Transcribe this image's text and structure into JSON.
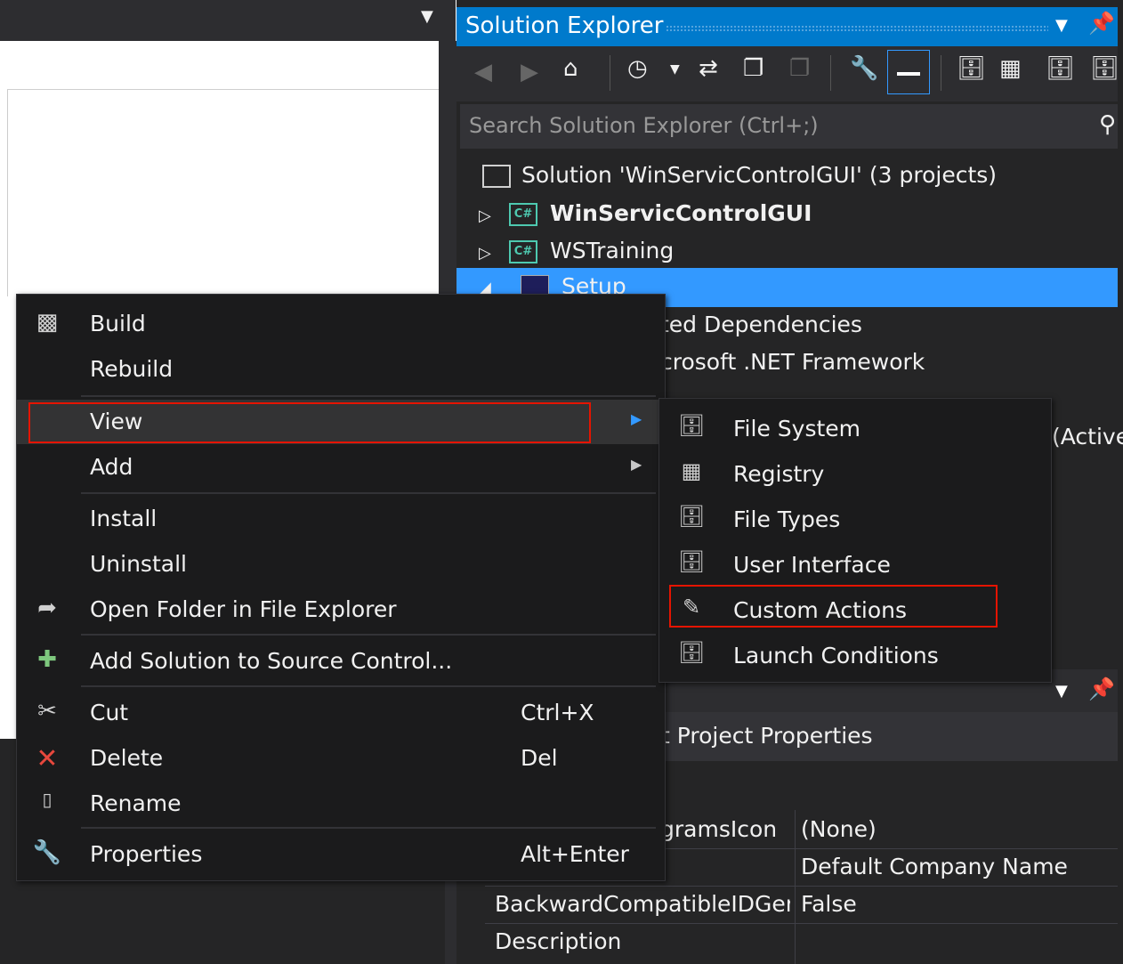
{
  "solution_explorer": {
    "title": "Solution Explorer",
    "search_placeholder": "Search Solution Explorer (Ctrl+;)",
    "tree": [
      {
        "label": "Solution 'WinServicControlGUI' (3 projects)",
        "icon": "solution-icon"
      },
      {
        "label": "WinServicControlGUI",
        "icon": "csharp-project-icon",
        "bold": true
      },
      {
        "label": "WSTraining",
        "icon": "csharp-project-icon"
      },
      {
        "label": "Setup",
        "icon": "setup-project-icon",
        "selected": true
      },
      {
        "label": "ted Dependencies"
      },
      {
        "label": "crosoft .NET Framework"
      },
      {
        "label": "(Active"
      }
    ]
  },
  "properties": {
    "subtitle": "t Project Properties",
    "rows": [
      {
        "name": "gramsIcon",
        "value": "(None)"
      },
      {
        "name": "",
        "value": "Default Company Name"
      },
      {
        "name": "BackwardCompatibleIDGen",
        "value": "False"
      },
      {
        "name": "Description",
        "value": ""
      }
    ]
  },
  "context_menu": {
    "items": [
      {
        "label": "Build",
        "icon": "build-icon"
      },
      {
        "label": "Rebuild"
      },
      {
        "label": "View",
        "submenu": true,
        "highlighted": true
      },
      {
        "label": "Add",
        "submenu": true
      },
      {
        "label": "Install"
      },
      {
        "label": "Uninstall"
      },
      {
        "label": "Open Folder in File Explorer",
        "icon": "open-folder-arrow-icon"
      },
      {
        "label": "Add Solution to Source Control...",
        "icon": "source-control-icon"
      },
      {
        "label": "Cut",
        "shortcut": "Ctrl+X",
        "icon": "scissors-icon"
      },
      {
        "label": "Delete",
        "shortcut": "Del",
        "icon": "delete-x-icon"
      },
      {
        "label": "Rename",
        "icon": "rename-icon"
      },
      {
        "label": "Properties",
        "shortcut": "Alt+Enter",
        "icon": "wrench-icon"
      }
    ]
  },
  "view_submenu": {
    "items": [
      {
        "label": "File System",
        "icon": "file-system-icon"
      },
      {
        "label": "Registry",
        "icon": "registry-icon"
      },
      {
        "label": "File Types",
        "icon": "file-types-icon"
      },
      {
        "label": "User Interface",
        "icon": "user-interface-icon"
      },
      {
        "label": "Custom Actions",
        "icon": "custom-actions-icon",
        "highlighted": true
      },
      {
        "label": "Launch Conditions",
        "icon": "launch-conditions-icon"
      }
    ]
  },
  "colors": {
    "accent": "#007acc",
    "selection": "#3399ff",
    "highlight_border": "#e51400",
    "menu_bg": "#1b1b1c"
  }
}
